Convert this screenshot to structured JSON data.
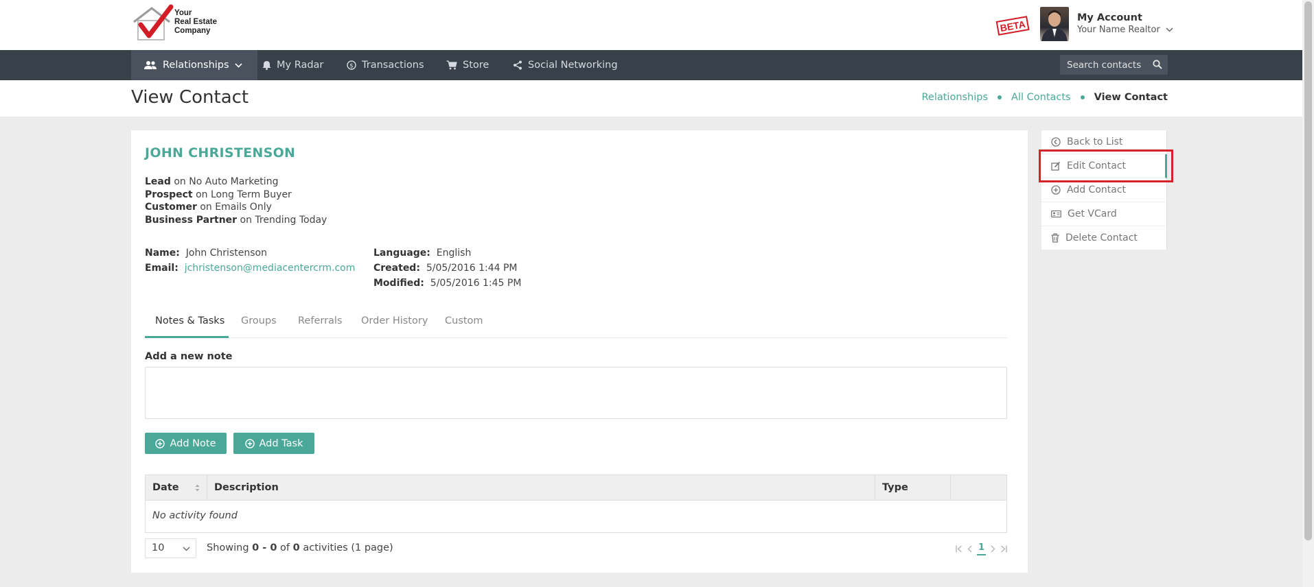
{
  "header": {
    "logo_lines": [
      "Your",
      "Real Estate",
      "Company"
    ],
    "beta_label": "BETA",
    "account_title": "My Account",
    "account_subtitle": "Your Name Realtor"
  },
  "nav": {
    "items": [
      {
        "label": "Relationships",
        "icon": "people-icon"
      },
      {
        "label": "My Radar",
        "icon": "bell-icon"
      },
      {
        "label": "Transactions",
        "icon": "dollar-circle-icon"
      },
      {
        "label": "Store",
        "icon": "cart-icon"
      },
      {
        "label": "Social Networking",
        "icon": "share-icon"
      }
    ],
    "search_placeholder": "Search contacts"
  },
  "titlebar": {
    "title": "View Contact",
    "breadcrumbs": [
      "Relationships",
      "All Contacts",
      "View Contact"
    ]
  },
  "contact": {
    "name": "JOHN CHRISTENSON",
    "statuses": [
      {
        "role": "Lead",
        "on": "on No Auto Marketing"
      },
      {
        "role": "Prospect",
        "on": "on Long Term Buyer"
      },
      {
        "role": "Customer",
        "on": "on Emails Only"
      },
      {
        "role": "Business Partner",
        "on": "on Trending Today"
      }
    ],
    "fields": {
      "name_label": "Name:",
      "name_value": "John Christenson",
      "email_label": "Email:",
      "email_value": "jchristenson@mediacentercrm.com",
      "language_label": "Language:",
      "language_value": "English",
      "created_label": "Created:",
      "created_value": "5/05/2016 1:44 PM",
      "modified_label": "Modified:",
      "modified_value": "5/05/2016 1:45 PM"
    }
  },
  "tabs": [
    "Notes & Tasks",
    "Groups",
    "Referrals",
    "Order History",
    "Custom"
  ],
  "notes": {
    "label": "Add a new note",
    "add_note": "Add Note",
    "add_task": "Add Task"
  },
  "table": {
    "headers": [
      "Date",
      "Description",
      "Type",
      ""
    ],
    "empty_text": "No activity found"
  },
  "pager": {
    "per_page": "10",
    "showing_prefix": "Showing ",
    "range": "0 - 0",
    "of": " of ",
    "total": "0",
    "suffix": " activities (1 page)",
    "current_page": "1"
  },
  "sidebar": {
    "items": [
      {
        "label": "Back to List",
        "icon": "back-circle-icon"
      },
      {
        "label": "Edit Contact",
        "icon": "edit-icon"
      },
      {
        "label": "Add Contact",
        "icon": "plus-circle-icon"
      },
      {
        "label": "Get VCard",
        "icon": "id-card-icon"
      },
      {
        "label": "Delete Contact",
        "icon": "trash-icon"
      }
    ]
  },
  "colors": {
    "accent": "#4aa898",
    "nav_bg": "#38404a",
    "highlight": "#d6212b"
  }
}
